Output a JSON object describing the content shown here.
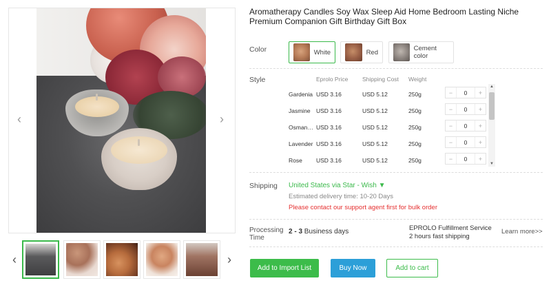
{
  "product": {
    "title": "Aromatherapy Candles Soy Wax Sleep Aid Home Bedroom Lasting Niche Premium Companion Gift Birthday Gift Box"
  },
  "labels": {
    "color": "Color",
    "style": "Style",
    "shipping": "Shipping",
    "processing": "Processing\nTime"
  },
  "colors": [
    {
      "label": "White",
      "selected": true
    },
    {
      "label": "Red",
      "selected": false
    },
    {
      "label": "Cement color",
      "selected": false
    }
  ],
  "style_table": {
    "headers": {
      "price": "Eprolo Price",
      "shipping": "Shipping Cost",
      "weight": "Weight"
    },
    "rows": [
      {
        "name": "Gardenia",
        "price": "USD 3.16",
        "shipping": "USD 5.12",
        "weight": "250g",
        "qty": "0"
      },
      {
        "name": "Jasmine",
        "price": "USD 3.16",
        "shipping": "USD 5.12",
        "weight": "250g",
        "qty": "0"
      },
      {
        "name": "Osmant…",
        "price": "USD 3.16",
        "shipping": "USD 5.12",
        "weight": "250g",
        "qty": "0"
      },
      {
        "name": "Lavender",
        "price": "USD 3.16",
        "shipping": "USD 5.12",
        "weight": "250g",
        "qty": "0"
      },
      {
        "name": "Rose",
        "price": "USD 3.16",
        "shipping": "USD 5.12",
        "weight": "250g",
        "qty": "0"
      }
    ],
    "stepper": {
      "minus": "−",
      "plus": "+"
    }
  },
  "shipping": {
    "method": "United States via Star - Wish ▼",
    "estimate": "Estimated delivery time: 10-20 Days",
    "warning": "Please contact our support agent first for bulk order"
  },
  "processing": {
    "days_bold": "2 - 3",
    "days_rest": " Business days",
    "fulfillment_line1": "EPROLO Fulfillment Service",
    "fulfillment_line2": "2 hours fast shipping",
    "learn_more": "Learn more>>"
  },
  "buttons": {
    "import": "Add to Import List",
    "buy": "Buy Now",
    "cart": "Add to cart"
  },
  "gallery": {
    "prev_icon": "‹",
    "next_icon": "›",
    "thumb_prev_icon": "‹",
    "thumb_next_icon": "›",
    "active_thumb": 0
  },
  "theme": {
    "accent_green": "#3cbc4a",
    "buy_blue": "#2c9fd8",
    "warning_red": "#e53030"
  }
}
